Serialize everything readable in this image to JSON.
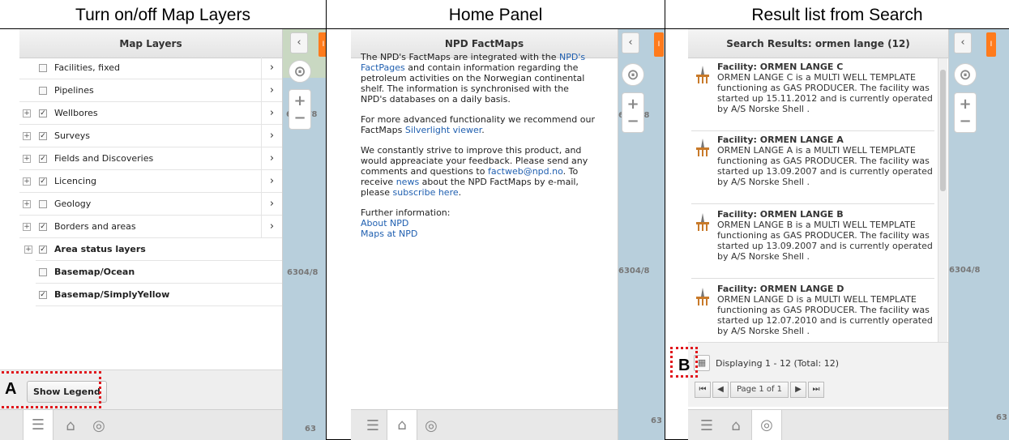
{
  "columns": {
    "left_title": "Turn on/off Map Layers",
    "middle_title": "Home Panel",
    "right_title": "Result list from Search"
  },
  "callouts": {
    "a": "A",
    "b": "B"
  },
  "map": {
    "labels": [
      "6304/8",
      "6304/8",
      "6304/8",
      "63",
      "63",
      "63"
    ],
    "collapse_glyph": "‹",
    "orange_glyph": "I"
  },
  "layers_panel": {
    "title": "Map Layers",
    "items": [
      {
        "label": "Facilities, fixed",
        "checked": false,
        "expandable": false,
        "chevron": "›"
      },
      {
        "label": "Pipelines",
        "checked": false,
        "expandable": false,
        "chevron": "›"
      },
      {
        "label": "Wellbores",
        "checked": true,
        "expandable": true,
        "chevron": "›"
      },
      {
        "label": "Surveys",
        "checked": true,
        "expandable": true,
        "chevron": "›"
      },
      {
        "label": "Fields and Discoveries",
        "checked": true,
        "expandable": true,
        "chevron": "›"
      },
      {
        "label": "Licencing",
        "checked": true,
        "expandable": true,
        "chevron": "›"
      },
      {
        "label": "Geology",
        "checked": false,
        "expandable": true,
        "chevron": "›"
      },
      {
        "label": "Borders and areas",
        "checked": true,
        "expandable": true,
        "chevron": "›"
      },
      {
        "label": "Area status layers",
        "checked": true,
        "expandable": true,
        "chevron": ""
      },
      {
        "label": "Basemap/Ocean",
        "checked": false,
        "expandable": false,
        "chevron": ""
      },
      {
        "label": "Basemap/SimplyYellow",
        "checked": true,
        "expandable": false,
        "chevron": ""
      }
    ],
    "show_legend_label": "Show Legend"
  },
  "home_panel": {
    "title": "NPD FactMaps",
    "p1_a": "The NPD's FactMaps are integrated with the ",
    "p1_link": "NPD's FactPages",
    "p1_b": " and contain information regarding the petroleum activities on the Norwegian continental shelf. The information is synchronised with the NPD's databases on a daily basis.",
    "p2_a": "For more advanced functionality we recommend our FactMaps ",
    "p2_link": "Silverlight viewer",
    "p2_b": ".",
    "p3_a": "We constantly strive to improve this product, and would appreaciate your feedback. Please send any comments and questions to ",
    "p3_link1": "factweb@npd.no",
    "p3_b": ". To receive ",
    "p3_link2": "news",
    "p3_c": " about the NPD FactMaps by e-mail, please ",
    "p3_link3": "subscribe here",
    "p3_d": ".",
    "further": "Further information:",
    "link_about": "About NPD",
    "link_maps": "Maps at NPD"
  },
  "search_panel": {
    "title": "Search Results: ormen lange (12)",
    "results": [
      {
        "title": "Facility: ORMEN LANGE C",
        "body": "ORMEN LANGE C is a MULTI WELL TEMPLATE functioning as GAS PRODUCER. The facility was started up 15.11.2012 and is currently operated by A/S Norske Shell ."
      },
      {
        "title": "Facility: ORMEN LANGE A",
        "body": "ORMEN LANGE A is a MULTI WELL TEMPLATE functioning as GAS PRODUCER. The facility was started up 13.09.2007 and is currently operated by A/S Norske Shell ."
      },
      {
        "title": "Facility: ORMEN LANGE B",
        "body": "ORMEN LANGE B is a MULTI WELL TEMPLATE functioning as GAS PRODUCER. The facility was started up 13.09.2007 and is currently operated by A/S Norske Shell ."
      },
      {
        "title": "Facility: ORMEN LANGE D",
        "body": "ORMEN LANGE D is a MULTI WELL TEMPLATE functioning as GAS PRODUCER. The facility was started up 12.07.2010 and is currently operated by A/S Norske Shell ."
      }
    ],
    "displaying": "Displaying 1 - 12 (Total: 12)",
    "page_label": "Page 1 of 1",
    "first_glyph": "⏮",
    "prev_glyph": "◀",
    "next_glyph": "▶",
    "last_glyph": "⏭"
  },
  "colors": {
    "accent_orange": "#ff7b1c",
    "callout_red": "#e0151b",
    "link_blue": "#1f5fb0",
    "sea": "#b8cfdc"
  }
}
